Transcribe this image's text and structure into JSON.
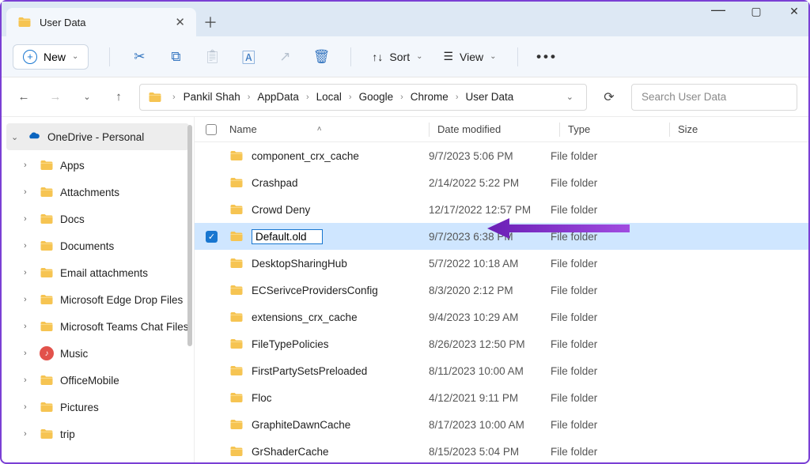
{
  "tab_title": "User Data",
  "toolbar": {
    "new_label": "New",
    "sort_label": "Sort",
    "view_label": "View"
  },
  "breadcrumb": [
    "Pankil Shah",
    "AppData",
    "Local",
    "Google",
    "Chrome",
    "User Data"
  ],
  "search_placeholder": "Search User Data",
  "sidebar": {
    "root": "OneDrive - Personal",
    "items": [
      "Apps",
      "Attachments",
      "Docs",
      "Documents",
      "Email attachments",
      "Microsoft Edge Drop Files",
      "Microsoft Teams Chat Files",
      "Music",
      "OfficeMobile",
      "Pictures",
      "trip"
    ]
  },
  "columns": {
    "name": "Name",
    "date": "Date modified",
    "type": "Type",
    "size": "Size"
  },
  "rename_value": "Default.old",
  "rows": [
    {
      "name": "component_crx_cache",
      "date": "9/7/2023 5:06 PM",
      "type": "File folder"
    },
    {
      "name": "Crashpad",
      "date": "2/14/2022 5:22 PM",
      "type": "File folder"
    },
    {
      "name": "Crowd Deny",
      "date": "12/17/2022 12:57 PM",
      "type": "File folder"
    },
    {
      "name": "Default.old",
      "date": "9/7/2023 6:38 PM",
      "type": "File folder",
      "selected": true,
      "editing": true
    },
    {
      "name": "DesktopSharingHub",
      "date": "5/7/2022 10:18 AM",
      "type": "File folder"
    },
    {
      "name": "ECSerivceProvidersConfig",
      "date": "8/3/2020 2:12 PM",
      "type": "File folder"
    },
    {
      "name": "extensions_crx_cache",
      "date": "9/4/2023 10:29 AM",
      "type": "File folder"
    },
    {
      "name": "FileTypePolicies",
      "date": "8/26/2023 12:50 PM",
      "type": "File folder"
    },
    {
      "name": "FirstPartySetsPreloaded",
      "date": "8/11/2023 10:00 AM",
      "type": "File folder"
    },
    {
      "name": "Floc",
      "date": "4/12/2021 9:11 PM",
      "type": "File folder"
    },
    {
      "name": "GraphiteDawnCache",
      "date": "8/17/2023 10:00 AM",
      "type": "File folder"
    },
    {
      "name": "GrShaderCache",
      "date": "8/15/2023 5:04 PM",
      "type": "File folder"
    }
  ]
}
